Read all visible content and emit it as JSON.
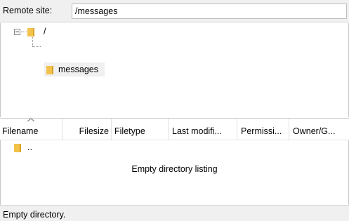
{
  "remote_site": {
    "label": "Remote site:",
    "path": "/messages"
  },
  "tree": {
    "root": {
      "label": "/",
      "icon": "folder-icon"
    },
    "children": [
      {
        "label": "messages",
        "icon": "folder-icon"
      }
    ]
  },
  "file_list": {
    "columns": [
      "Filename",
      "Filesize",
      "Filetype",
      "Last modifi...",
      "Permissi...",
      "Owner/G..."
    ],
    "sorted_column": "Filename",
    "rows": [
      {
        "name": "..",
        "icon": "folder-icon"
      }
    ],
    "empty_message": "Empty directory listing"
  },
  "status_bar": {
    "text": "Empty directory."
  },
  "colors": {
    "folder": "#f2c24a",
    "panel_bg": "#f0f0f0",
    "border": "#c6c6c6"
  }
}
